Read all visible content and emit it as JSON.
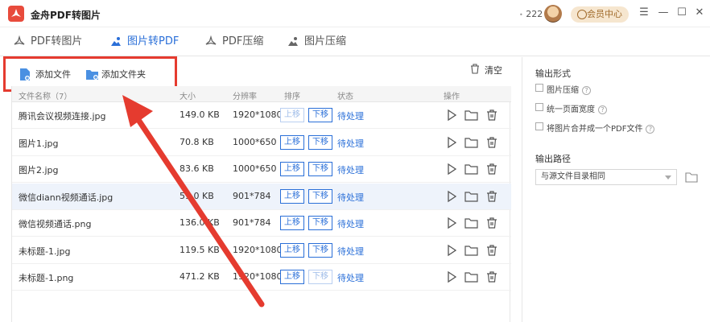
{
  "app": {
    "title": "金舟PDF转图片",
    "user_count": "222",
    "vip_label": "会员中心",
    "brand_color": "#e84b3c",
    "accent_color": "#2a6fd8"
  },
  "tabs": [
    {
      "label": "PDF转图片",
      "icon": "pdf-convert-icon",
      "active": false
    },
    {
      "label": "图片转PDF",
      "icon": "image-convert-icon",
      "active": true
    },
    {
      "label": "PDF压缩",
      "icon": "pdf-compress-icon",
      "active": false
    },
    {
      "label": "图片压缩",
      "icon": "image-compress-icon",
      "active": false
    }
  ],
  "toolbar": {
    "add_file": "添加文件",
    "add_folder": "添加文件夹",
    "clear": "清空"
  },
  "table": {
    "headers": {
      "name": "文件名称（7）",
      "size": "大小",
      "resolution": "分辨率",
      "order": "排序",
      "status": "状态",
      "actions": "操作"
    },
    "up_label": "上移",
    "down_label": "下移",
    "rows": [
      {
        "name": "腾讯会议视频连接.jpg",
        "size": "149.0 KB",
        "resolution": "1920*1080",
        "status": "待处理",
        "up_enabled": false,
        "down_enabled": true,
        "selected": false
      },
      {
        "name": "图片1.jpg",
        "size": "70.8 KB",
        "resolution": "1000*650",
        "status": "待处理",
        "up_enabled": true,
        "down_enabled": true,
        "selected": false
      },
      {
        "name": "图片2.jpg",
        "size": "83.6 KB",
        "resolution": "1000*650",
        "status": "待处理",
        "up_enabled": true,
        "down_enabled": true,
        "selected": false
      },
      {
        "name": "微信diann视频通话.jpg",
        "size": "59.0 KB",
        "resolution": "901*784",
        "status": "待处理",
        "up_enabled": true,
        "down_enabled": true,
        "selected": true
      },
      {
        "name": "微信视频通话.png",
        "size": "136.0 KB",
        "resolution": "901*784",
        "status": "待处理",
        "up_enabled": true,
        "down_enabled": true,
        "selected": false
      },
      {
        "name": "未标题-1.jpg",
        "size": "119.5 KB",
        "resolution": "1920*1080",
        "status": "待处理",
        "up_enabled": true,
        "down_enabled": true,
        "selected": false
      },
      {
        "name": "未标题-1.png",
        "size": "471.2 KB",
        "resolution": "1920*1080",
        "status": "待处理",
        "up_enabled": true,
        "down_enabled": false,
        "selected": false
      }
    ]
  },
  "right_panel": {
    "output_format_title": "输出形式",
    "options": [
      {
        "label": "图片压缩",
        "checked": false
      },
      {
        "label": "统一页面宽度",
        "checked": false
      },
      {
        "label": "将图片合并成一个PDF文件",
        "checked": false
      }
    ],
    "output_path_title": "输出路径",
    "output_path_value": "与源文件目录相同"
  }
}
